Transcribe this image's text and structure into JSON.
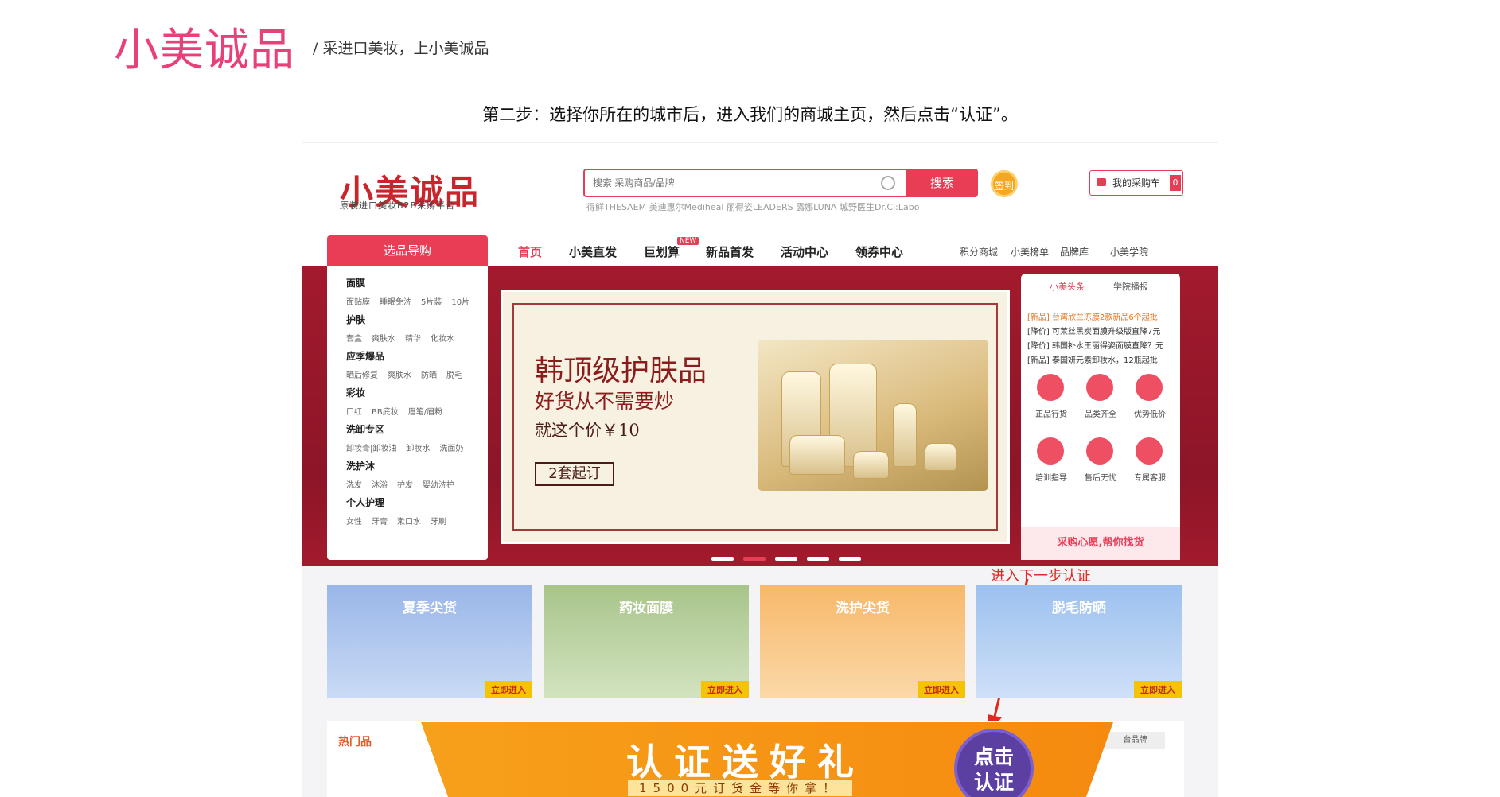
{
  "page": {
    "logo": "小美诚品",
    "slogan": "/  采进口美妆，上小美诚品",
    "step_text": "第二步：选择你所在的城市后，进入我们的商城主页，然后点击“认证”。",
    "accent_color": "#e64a8b"
  },
  "site": {
    "logo": "小美诚品",
    "logo_sub": "原装进口美妆B2B采购平台",
    "search_placeholder": "搜索 采购商品/品牌",
    "search_button": "搜索",
    "hot_words": "得鲜THESAEM  美迪惠尔Mediheal  丽得姿LEADERS  露娜LUNA  城野医生Dr.Ci:Labo",
    "signin": "签到",
    "cart_label": "我的采购车",
    "cart_count": "0",
    "brand_color": "#e83d55"
  },
  "nav": {
    "category_title": "选品导购",
    "main": [
      "首页",
      "小美直发",
      "巨划算",
      "新品首发",
      "活动中心",
      "领券中心"
    ],
    "new_badge": "NEW",
    "right": [
      "积分商城",
      "小美榜单",
      "品牌库",
      "小美学院"
    ]
  },
  "categories": [
    {
      "title": "面膜",
      "items": [
        "面贴膜",
        "睡眠免洗",
        "5片装",
        "10片"
      ]
    },
    {
      "title": "护肤",
      "items": [
        "套盒",
        "爽肤水",
        "精华",
        "化妆水"
      ]
    },
    {
      "title": "应季爆品",
      "items": [
        "晒后修复",
        "爽肤水",
        "防晒",
        "脱毛"
      ]
    },
    {
      "title": "彩妆",
      "items": [
        "口红",
        "BB底妆",
        "眉笔/眉粉"
      ]
    },
    {
      "title": "洗卸专区",
      "items": [
        "卸妆膏|卸妆油",
        "卸妆水",
        "洗面奶"
      ]
    },
    {
      "title": "洗护沐",
      "items": [
        "洗发",
        "沐浴",
        "护发",
        "婴幼洗护"
      ]
    },
    {
      "title": "个人护理",
      "items": [
        "女性",
        "牙膏",
        "漱口水",
        "牙刷"
      ]
    }
  ],
  "promo": {
    "headline": "韩顶级护肤品",
    "sub": "好货从不需要炒",
    "price": "就这个价￥10",
    "box": "2套起订"
  },
  "news": {
    "tabs": [
      "小美头条",
      "学院播报"
    ],
    "items": [
      "[新品] 台湾欣兰冻膜2款新品6个起批",
      "[降价] 可莱丝黑炭面膜升级版直降7元",
      "[降价] 韩国补水王丽得姿面膜直降？元",
      "[新品] 泰国妍元素卸妆水，12瓶起批"
    ],
    "services": [
      "正品行货",
      "品类齐全",
      "优势低价",
      "培训指导",
      "售后无忧",
      "专属客服"
    ],
    "help": "采购心愿,帮你找货"
  },
  "annotation": "进入下一步认证",
  "tiles": [
    {
      "title": "夏季尖货",
      "go": "立即进入",
      "color": "#9ab6e8"
    },
    {
      "title": "药妆面膜",
      "go": "立即进入",
      "color": "#a8c48a"
    },
    {
      "title": "洗护尖货",
      "go": "立即进入",
      "color": "#f7b86a"
    },
    {
      "title": "脱毛防晒",
      "go": "立即进入",
      "color": "#9cc1ef"
    }
  ],
  "lower": {
    "hot_label": "热门品",
    "ad_title": "认证送好礼",
    "ad_sub": "1500元订货金等你拿！",
    "ad_button": "点击\n认证",
    "right_tab": "台品牌"
  }
}
